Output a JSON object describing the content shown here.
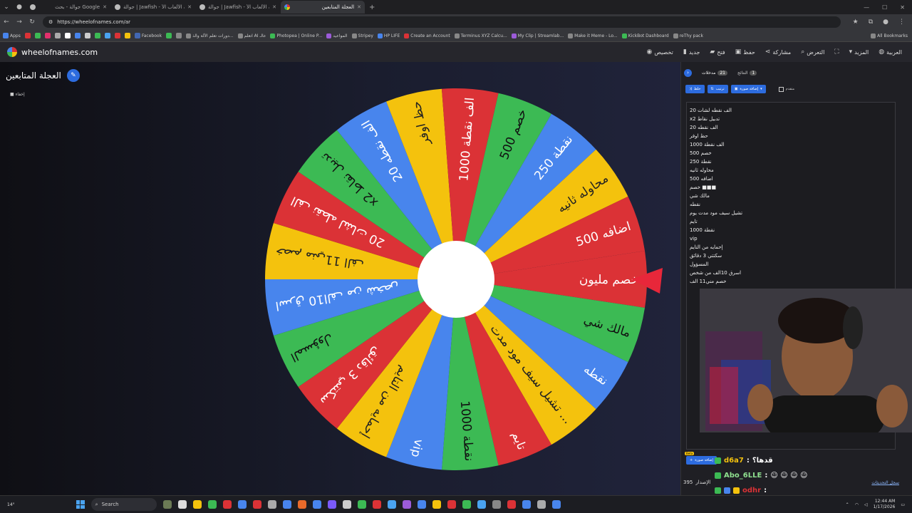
{
  "browser": {
    "tabs": [
      {
        "title": "جوالة - بحث Google"
      },
      {
        "title": "جوالة | Jawfish - منصة الألعاب الأ..."
      },
      {
        "title": "جوالة | Jawfish - منصة الألعاب الأ..."
      },
      {
        "title": "العجلة المتابعين"
      }
    ],
    "url": "https://wheelofnames.com/ar",
    "bookmarks": [
      "Apps",
      "",
      "",
      "",
      "",
      "",
      "",
      "",
      "",
      "",
      "",
      "",
      "Facebook",
      "",
      "",
      "دورات تعلم الآلة والذ...",
      "اتعلم AI عالـ",
      "Photopea | Online P...",
      "المواعيد",
      "Stripey",
      "HP LIFE",
      "Create an Account",
      "Terminus XYZ Calcu...",
      "My Clip | Streamlab...",
      "Make it Meme - Lo...",
      "KickBot Dashboard",
      "reThy pack"
    ],
    "all_bookmarks": "All Bookmarks"
  },
  "app": {
    "logo_text": "wheelofnames.com",
    "menu": [
      {
        "label": "العربية",
        "icon": "globe-icon"
      },
      {
        "label": "المزيد",
        "icon": "chevron-down-icon"
      },
      {
        "label": "",
        "icon": "fullscreen-icon"
      },
      {
        "label": "التعرض",
        "icon": "search-icon"
      },
      {
        "label": "مشاركة",
        "icon": "share-icon"
      },
      {
        "label": "حفظ",
        "icon": "save-icon"
      },
      {
        "label": "فتح",
        "icon": "folder-icon"
      },
      {
        "label": "جديد",
        "icon": "file-icon"
      },
      {
        "label": "تخصيص",
        "icon": "palette-icon"
      }
    ]
  },
  "wheel": {
    "title": "العجلة المتابعين",
    "hide_label": "إخفاء",
    "segments": [
      "خصم مليون",
      "مالك شي",
      "نقطه",
      "تشيل سيف مود مدت ...",
      "تايم",
      "1000 نقطة",
      "vip",
      "إحمايه من التايم",
      "سكتتي 3 دقائق",
      "المسؤول",
      "اسرق 10الف من شخص",
      "خصم مني11 الف",
      "20 الف نقطه لشات",
      "x2 تدبيل نقاط",
      "20 الف نقطه",
      "حظ اوفر",
      "الف نقطة 1000",
      "خصم 500",
      "نقطة 250",
      "محاوله ثانيه",
      "اضافه 500"
    ],
    "colors": [
      "#db3236",
      "#3cba54",
      "#4885ed",
      "#f4c20d"
    ]
  },
  "panel": {
    "tab_entries": "مدخلات",
    "entries_count": "21",
    "tab_results": "النتائج",
    "results_count": "1",
    "btn_shuffle": "خلط",
    "btn_sort": "ترتيب",
    "btn_add_image": "إضافة صورة",
    "advanced": "متقدم",
    "entries": [
      "20 الف نقطه لشات",
      "x2 تدبيل نقاط",
      "20 الف نقطه",
      "حظ اوفر",
      "1000 الف نقطة",
      "500 خصم",
      "250 نقطة",
      "محاوله ثانيه",
      "500 اضافه",
      "خصم ■■■",
      "مالك شي",
      "نقطه",
      "تشيل سيف مود مدت يوم",
      "تايم",
      "1000 نقطة",
      "vip",
      "إحمايه من التايم",
      "سكتتي 3 دقائق",
      "المسؤول",
      "اسرق 10الف من شخص",
      "خصم مني11 الف"
    ],
    "beta_badge": "Beta",
    "add_image_label": "إضافة صورة",
    "version_label": "الإصدار",
    "version_number": "395",
    "saved_lists": "سجل التحديثات"
  },
  "chat": [
    {
      "user": "d6a7",
      "message": "قدها؟"
    },
    {
      "user": "Abo_6LLE",
      "message": "☺ ☺ ☺ ☺"
    },
    {
      "user": "odhr",
      "message": ""
    }
  ],
  "taskbar": {
    "weather": "14°",
    "search_placeholder": "Search",
    "time": "12:44 AM",
    "date": "1/17/2026"
  }
}
